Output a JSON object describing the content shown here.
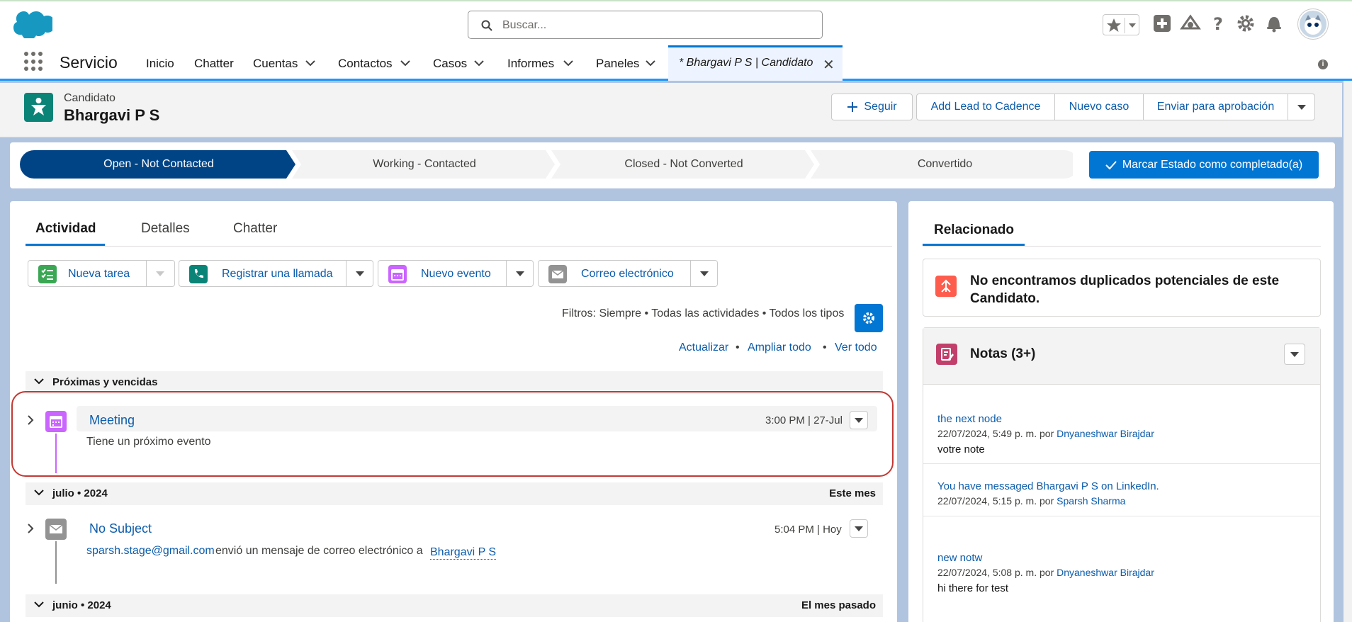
{
  "header": {
    "search_placeholder": "Buscar...",
    "icons": [
      "favorites-star-icon",
      "add-icon",
      "trailhead-icon",
      "help-icon",
      "setup-gear-icon",
      "notifications-bell-icon",
      "avatar"
    ]
  },
  "nav": {
    "app_name": "Servicio",
    "items": [
      {
        "label": "Inicio",
        "dropdown": false
      },
      {
        "label": "Chatter",
        "dropdown": false
      },
      {
        "label": "Cuentas",
        "dropdown": true
      },
      {
        "label": "Contactos",
        "dropdown": true
      },
      {
        "label": "Casos",
        "dropdown": true
      },
      {
        "label": "Informes",
        "dropdown": true
      },
      {
        "label": "Paneles",
        "dropdown": true
      }
    ],
    "open_tab": "* Bhargavi P S | Candidato"
  },
  "record": {
    "type": "Candidato",
    "name": "Bhargavi P S",
    "actions": {
      "follow": "Seguir",
      "add_cadence": "Add Lead to Cadence",
      "new_case": "Nuevo caso",
      "submit_approval": "Enviar para aprobación"
    }
  },
  "path": {
    "steps": [
      "Open - Not Contacted",
      "Working - Contacted",
      "Closed - Not Converted",
      "Convertido"
    ],
    "current_step_index": 0,
    "complete_button": "Marcar Estado como completado(a)"
  },
  "activity": {
    "tabs": [
      "Actividad",
      "Detalles",
      "Chatter"
    ],
    "buttons": {
      "new_task": "Nueva tarea",
      "log_call": "Registrar una llamada",
      "new_event": "Nuevo evento",
      "email": "Correo electrónico"
    },
    "filters": "Filtros: Siempre • Todas las actividades • Todos los tipos",
    "links": {
      "refresh": "Actualizar",
      "expand_all": "Ampliar todo",
      "view_all": "Ver todo",
      "sep": "•"
    },
    "sections": {
      "upcoming": {
        "title": "Próximas y vencidas",
        "item": {
          "title": "Meeting",
          "time": "3:00 PM | 27-Jul",
          "desc": "Tiene un próximo evento"
        }
      },
      "july": {
        "title": "julio • 2024",
        "right": "Este mes",
        "item": {
          "title": "No Subject",
          "time": "5:04 PM | Hoy",
          "sender": "sparsh.stage@gmail.com",
          "desc_middle": "envió un mensaje de correo electrónico a",
          "recipient": "Bhargavi P S"
        }
      },
      "june": {
        "title": "junio • 2024",
        "right": "El mes pasado"
      }
    }
  },
  "related": {
    "tab": "Relacionado",
    "duplicates_message": "No encontramos duplicados potenciales de este Candidato.",
    "notes": {
      "title": "Notas (3+)",
      "items": [
        {
          "title": "the next node",
          "meta": "22/07/2024, 5:49 p. m. por",
          "author": "Dnyaneshwar Birajdar",
          "body": "votre note"
        },
        {
          "title": "You have messaged Bhargavi P S on LinkedIn.",
          "meta": "22/07/2024, 5:15 p. m. por",
          "author": "Sparsh Sharma",
          "body": ""
        },
        {
          "title": "new notw",
          "meta": "22/07/2024, 5:08 p. m. por",
          "author": "Dnyaneshwar Birajdar",
          "body": "hi there for test"
        }
      ]
    }
  },
  "colors": {
    "brand": "#0176d3",
    "path_current": "#014486",
    "task_icon": "#3ba755",
    "call_icon": "#0b8478",
    "event_icon": "#cb65ff",
    "email_icon": "#939393",
    "highlight_border": "#c23934"
  }
}
